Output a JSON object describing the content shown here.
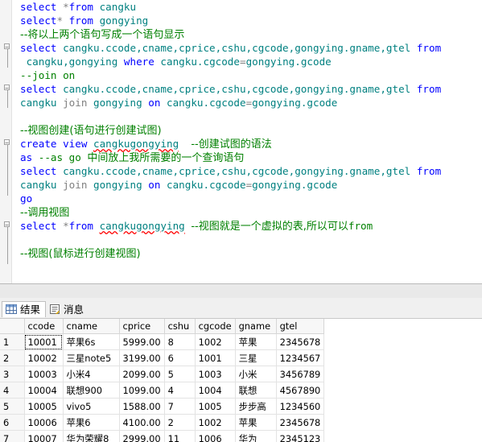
{
  "editor": {
    "lines": [
      {
        "tokens": [
          {
            "t": "select ",
            "c": "kw"
          },
          {
            "t": "*",
            "c": "op"
          },
          {
            "t": "from ",
            "c": "kw"
          },
          {
            "t": "cangku",
            "c": "id"
          }
        ]
      },
      {
        "tokens": [
          {
            "t": "select",
            "c": "kw"
          },
          {
            "t": "* ",
            "c": "op"
          },
          {
            "t": "from ",
            "c": "kw"
          },
          {
            "t": "gongying",
            "c": "id"
          }
        ]
      },
      {
        "tokens": [
          {
            "t": "--将以上两个语句写成一个语句显示",
            "c": "cm"
          }
        ]
      },
      {
        "tokens": [
          {
            "t": "select ",
            "c": "kw"
          },
          {
            "t": "cangku.ccode,cname,cprice,cshu,cgcode,gongying.gname,gtel ",
            "c": "id"
          },
          {
            "t": "from",
            "c": "kw"
          }
        ]
      },
      {
        "tokens": [
          {
            "t": " cangku,gongying ",
            "c": "id"
          },
          {
            "t": "where ",
            "c": "kw"
          },
          {
            "t": "cangku.cgcode",
            "c": "id"
          },
          {
            "t": "=",
            "c": "op"
          },
          {
            "t": "gongying.gcode",
            "c": "id"
          }
        ]
      },
      {
        "tokens": [
          {
            "t": "--join on",
            "c": "cmm"
          }
        ]
      },
      {
        "tokens": [
          {
            "t": "select ",
            "c": "kw"
          },
          {
            "t": "cangku.ccode,cname,cprice,cshu,cgcode,gongying.gname,gtel ",
            "c": "id"
          },
          {
            "t": "from",
            "c": "kw"
          }
        ]
      },
      {
        "tokens": [
          {
            "t": "cangku ",
            "c": "id"
          },
          {
            "t": "join ",
            "c": "op"
          },
          {
            "t": "gongying ",
            "c": "id"
          },
          {
            "t": "on ",
            "c": "kw"
          },
          {
            "t": "cangku.cgcode",
            "c": "id"
          },
          {
            "t": "=",
            "c": "op"
          },
          {
            "t": "gongying.gcode",
            "c": "id"
          }
        ]
      },
      {
        "tokens": []
      },
      {
        "tokens": [
          {
            "t": "--视图创建(语句进行创建试图)",
            "c": "cm"
          }
        ]
      },
      {
        "tokens": [
          {
            "t": "create view ",
            "c": "kw"
          },
          {
            "t": "cangkugongying",
            "c": "id sq"
          },
          {
            "t": "  ",
            "c": "id"
          },
          {
            "t": "--创建试图的语法",
            "c": "cm"
          }
        ]
      },
      {
        "tokens": [
          {
            "t": "as ",
            "c": "kw"
          },
          {
            "t": "--as go ",
            "c": "cmm"
          },
          {
            "t": "中间放上我所需要的一个查询语句",
            "c": "cm"
          }
        ]
      },
      {
        "tokens": [
          {
            "t": "select ",
            "c": "kw"
          },
          {
            "t": "cangku.ccode,cname,cprice,cshu,cgcode,gongying.gname,gtel ",
            "c": "id"
          },
          {
            "t": "from",
            "c": "kw"
          }
        ]
      },
      {
        "tokens": [
          {
            "t": "cangku ",
            "c": "id"
          },
          {
            "t": "join ",
            "c": "op"
          },
          {
            "t": "gongying ",
            "c": "id"
          },
          {
            "t": "on ",
            "c": "kw"
          },
          {
            "t": "cangku.cgcode",
            "c": "id"
          },
          {
            "t": "=",
            "c": "op"
          },
          {
            "t": "gongying.gcode",
            "c": "id"
          }
        ]
      },
      {
        "tokens": [
          {
            "t": "go",
            "c": "kw"
          }
        ]
      },
      {
        "tokens": [
          {
            "t": "--调用视图",
            "c": "cm"
          }
        ]
      },
      {
        "tokens": [
          {
            "t": "select ",
            "c": "kw"
          },
          {
            "t": "*",
            "c": "op"
          },
          {
            "t": "from ",
            "c": "kw"
          },
          {
            "t": "cangkugongying",
            "c": "id sq"
          },
          {
            "t": " ",
            "c": "id"
          },
          {
            "t": "--视图就是一个虚拟的表,所以可以",
            "c": "cm"
          },
          {
            "t": "from",
            "c": "cmm"
          }
        ]
      },
      {
        "tokens": []
      },
      {
        "tokens": [
          {
            "t": "--视图(鼠标进行创建视图)",
            "c": "cm"
          }
        ]
      }
    ]
  },
  "tabs": [
    {
      "label": "结果",
      "icon": "grid-icon",
      "active": true
    },
    {
      "label": "消息",
      "icon": "messages-icon",
      "active": false
    }
  ],
  "grid": {
    "columns": [
      "ccode",
      "cname",
      "cprice",
      "cshu",
      "cgcode",
      "gname",
      "gtel"
    ],
    "rows": [
      [
        "1",
        "10001",
        "苹果6s",
        "5999.00",
        "8",
        "1002",
        "苹果",
        "2345678"
      ],
      [
        "2",
        "10002",
        "三星note5",
        "3199.00",
        "6",
        "1001",
        "三星",
        "1234567"
      ],
      [
        "3",
        "10003",
        "小米4",
        "2099.00",
        "5",
        "1003",
        "小米",
        "3456789"
      ],
      [
        "4",
        "10004",
        "联想900",
        "1099.00",
        "4",
        "1004",
        "联想",
        "4567890"
      ],
      [
        "5",
        "10005",
        "vivo5",
        "1588.00",
        "7",
        "1005",
        "步步高",
        "1234560"
      ],
      [
        "6",
        "10006",
        "苹果6",
        "4100.00",
        "2",
        "1002",
        "苹果",
        "2345678"
      ],
      [
        "7",
        "10007",
        "华为荣耀8",
        "2999.00",
        "11",
        "1006",
        "华为",
        "2345123"
      ]
    ]
  }
}
